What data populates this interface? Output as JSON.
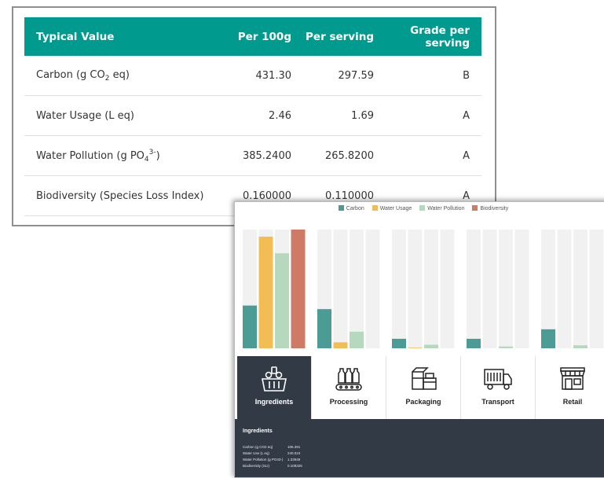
{
  "table": {
    "headers": [
      "Typical Value",
      "Per 100g",
      "Per serving",
      "Grade per serving"
    ],
    "rows": [
      {
        "label_main": "Carbon (g CO",
        "label_sub": "2",
        "label_sup": "",
        "label_end": " eq)",
        "per_100g": "431.30",
        "per_serving": "297.59",
        "grade": "B"
      },
      {
        "label_main": "Water Usage (L eq)",
        "label_sub": "",
        "label_sup": "",
        "label_end": "",
        "per_100g": "2.46",
        "per_serving": "1.69",
        "grade": "A"
      },
      {
        "label_main": "Water Pollution (g PO",
        "label_sub": "4",
        "label_sup": "3-",
        "label_end": ")",
        "per_100g": "385.2400",
        "per_serving": "265.8200",
        "grade": "A"
      },
      {
        "label_main": "Biodiversity (Species Loss Index)",
        "label_sub": "",
        "label_sup": "",
        "label_end": "",
        "per_100g": "0.160000",
        "per_serving": "0.110000",
        "grade": "A"
      }
    ]
  },
  "chart_data": {
    "type": "bar",
    "categories": [
      "Ingredients",
      "Processing",
      "Packaging",
      "Transport",
      "Retail"
    ],
    "series": [
      {
        "name": "Carbon",
        "color": "#4a9c94",
        "values": [
          0.36,
          0.33,
          0.08,
          0.08,
          0.16
        ]
      },
      {
        "name": "Water Usage",
        "color": "#f2bd55",
        "values": [
          0.94,
          0.05,
          0.005,
          0,
          0
        ]
      },
      {
        "name": "Water Pollution",
        "color": "#b6d8bd",
        "values": [
          0.8,
          0.14,
          0.03,
          0.015,
          0.025
        ]
      },
      {
        "name": "Biodiversity",
        "color": "#cf7a66",
        "values": [
          1.0,
          0,
          0,
          0,
          0
        ]
      }
    ],
    "ylim": [
      0,
      1
    ],
    "legend": "top-center",
    "track_color": "#f1f1f1"
  },
  "tabs": [
    {
      "id": "ingredients",
      "label": "Ingredients",
      "icon": "basket-icon",
      "active": true
    },
    {
      "id": "processing",
      "label": "Processing",
      "icon": "conveyor-bottles-icon",
      "active": false
    },
    {
      "id": "packaging",
      "label": "Packaging",
      "icon": "boxes-icon",
      "active": false
    },
    {
      "id": "transport",
      "label": "Transport",
      "icon": "truck-icon",
      "active": false
    },
    {
      "id": "retail",
      "label": "Retail",
      "icon": "shop-icon",
      "active": false
    }
  ],
  "detail": {
    "title": "Ingredients",
    "rows": [
      {
        "label": "Carbon (g CO2 eq)",
        "value": "106.391"
      },
      {
        "label": "Water Use (L eq)",
        "value": "240.024"
      },
      {
        "label": "Water Pollution (g PO43-)",
        "value": "1.33949"
      },
      {
        "label": "Biodiversity (SLI)",
        "value": "0.108325"
      }
    ]
  }
}
